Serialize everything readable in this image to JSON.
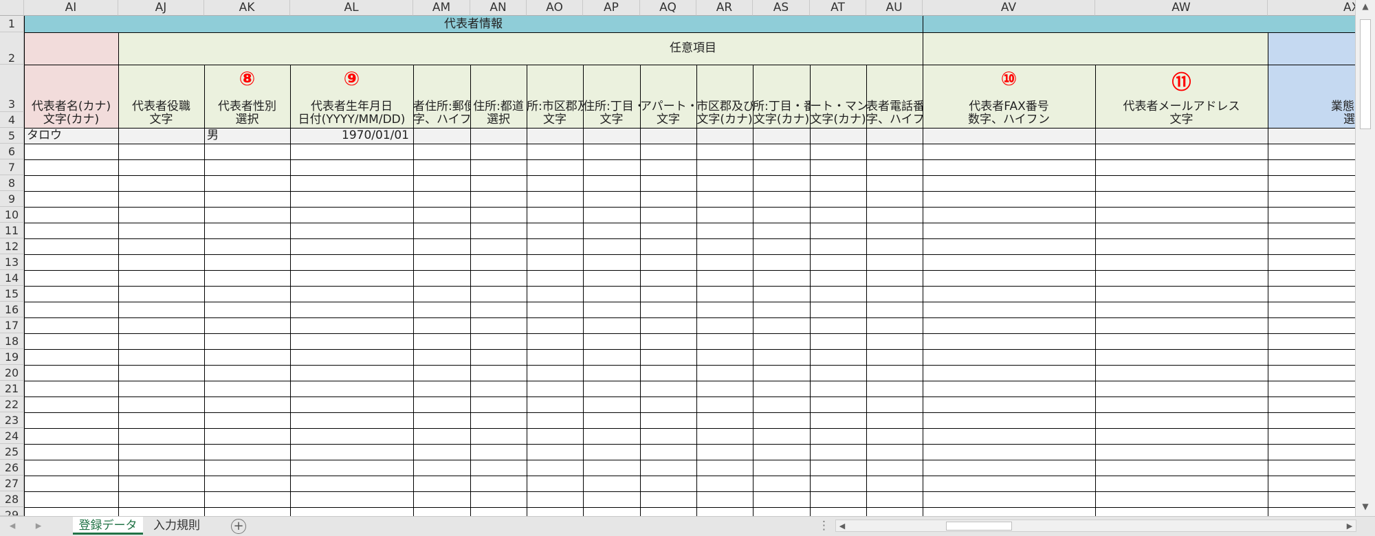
{
  "columns": [
    "AI",
    "AJ",
    "AK",
    "AL",
    "AM",
    "AN",
    "AO",
    "AP",
    "AQ",
    "AR",
    "AS",
    "AT",
    "AU",
    "AV",
    "AW",
    "AX"
  ],
  "rows": [
    "1",
    "2",
    "3",
    "4",
    "5",
    "6",
    "7",
    "8",
    "9",
    "10",
    "11",
    "12",
    "13",
    "14",
    "15",
    "16",
    "17",
    "18",
    "19",
    "20",
    "21",
    "22",
    "23",
    "24",
    "25",
    "26",
    "27",
    "28",
    "29"
  ],
  "row1": {
    "merged_title": "代表者情報"
  },
  "row2": {
    "merged_title": "任意項目"
  },
  "markers": {
    "ak": "⑧",
    "al": "⑨",
    "av": "⑩",
    "aw": "⑪"
  },
  "row3": [
    "代表者名(カナ)",
    "代表者役職",
    "代表者性別",
    "代表者生年月日",
    "者住所:郵便",
    "住所:都道",
    "所:市区郡及",
    "住所:丁目・",
    "アパート・マ",
    "市区郡及び",
    "所:丁目・番",
    "ート・マン",
    "表者電話番",
    "代表者FAX番号",
    "代表者メールアドレス",
    "業態"
  ],
  "row4": [
    "文字(カナ)",
    "文字",
    "選択",
    "日付(YYYY/MM/DD)",
    "字、ハイフ",
    "選択",
    "文字",
    "文字",
    "文字",
    "文字(カナ)",
    "文字(カナ)",
    "文字(カナ)",
    "字、ハイフ",
    "数字、ハイフン",
    "文字",
    "選"
  ],
  "row5": {
    "ai": "タロウ",
    "ak": "男",
    "al": "1970/01/01"
  },
  "tabs": {
    "active": "登録データ",
    "other": "入力規則",
    "add": "+"
  },
  "icons": {
    "scroll_up": "▲",
    "scroll_down": "▼",
    "scroll_left": "◀",
    "scroll_right": "▶",
    "nav_prev": "◂",
    "nav_next": "▸",
    "options": "⋮"
  },
  "colors": {
    "blue_header": "#8fcdd8",
    "pink": "#f2dcdb",
    "light_green": "#ebf1de",
    "light_blue": "#c5d9f1",
    "row5_gray": "#f2f2f2",
    "active_tab": "#217346"
  }
}
